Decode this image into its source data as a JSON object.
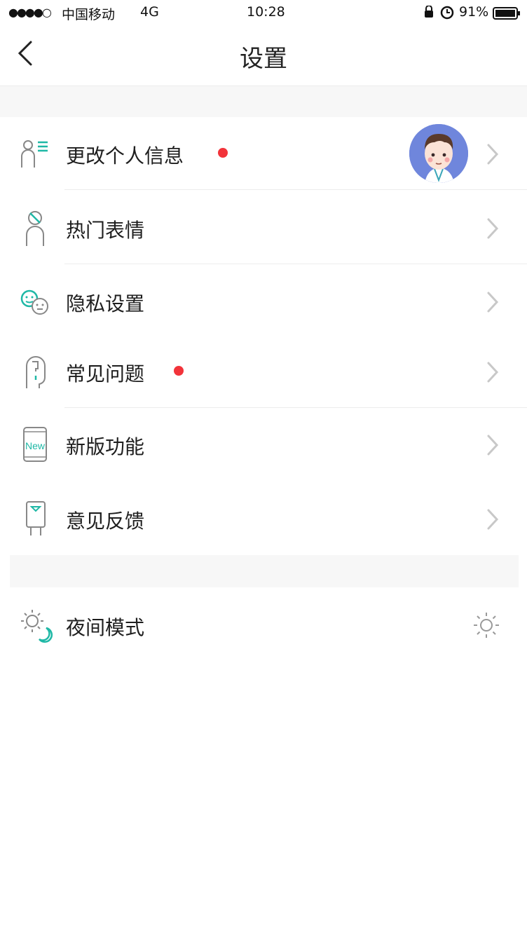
{
  "status_bar": {
    "signal": "●●●●○",
    "carrier": "中国移动",
    "network": "4G",
    "time": "10:28",
    "battery_percent": "91%"
  },
  "nav": {
    "title": "设置",
    "back_icon": "chevron-left-icon"
  },
  "menu": [
    {
      "label": "更改个人信息",
      "icon": "profile-info-icon",
      "has_dot": true,
      "has_avatar": true
    },
    {
      "label": "热门表情",
      "icon": "sticker-icon",
      "has_dot": false
    },
    {
      "label": "隐私设置",
      "icon": "privacy-faces-icon",
      "has_dot": false
    },
    {
      "label": "常见问题",
      "icon": "question-icon",
      "has_dot": true
    },
    {
      "label": "新版功能",
      "icon": "new-phone-icon",
      "has_dot": false
    },
    {
      "label": "意见反馈",
      "icon": "feedback-icon",
      "has_dot": false
    }
  ],
  "night_mode": {
    "label": "夜间模式",
    "icon": "sun-moon-icon",
    "toggle_icon": "sun-icon"
  },
  "colors": {
    "accent": "#1fb8a6",
    "dot": "#f2333a",
    "avatar_bg": "#6f86dc",
    "section_gap": "#f7f7f7"
  },
  "new_badge_text": "New"
}
